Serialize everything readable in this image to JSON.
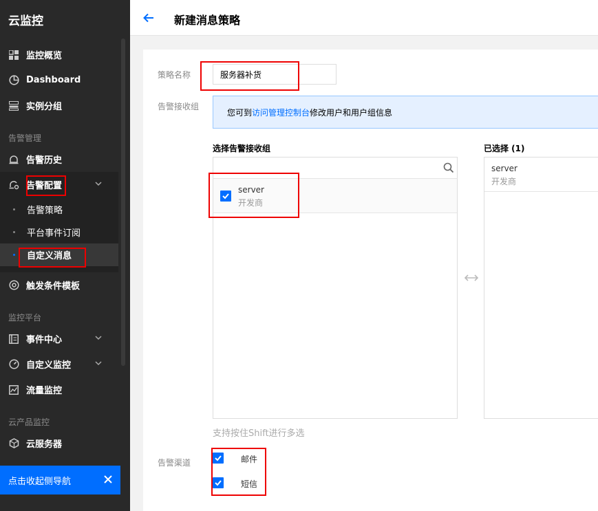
{
  "sidebar": {
    "app_title": "云监控",
    "items": [
      {
        "label": "监控概览",
        "icon": "grid-icon"
      },
      {
        "label": "Dashboard",
        "icon": "pie-chart-icon"
      },
      {
        "label": "实例分组",
        "icon": "list-group-icon"
      }
    ],
    "group_alarm": "告警管理",
    "alarm_history": "告警历史",
    "alarm_config": "告警配置",
    "sub_items": [
      "告警策略",
      "平台事件订阅",
      "自定义消息"
    ],
    "trigger_template": "触发条件模板",
    "group_platform": "监控平台",
    "event_center": "事件中心",
    "custom_monitor": "自定义监控",
    "traffic_monitor": "流量监控",
    "group_products": "云产品监控",
    "cvm": "云服务器",
    "toast": "点击收起侧导航"
  },
  "header": {
    "title": "新建消息策略"
  },
  "form": {
    "name_label": "策略名称",
    "name_value": "服务器补货",
    "receiver_label": "告警接收组",
    "info_prefix": "您可到",
    "info_link": "访问管理控制台",
    "info_suffix": "修改用户和用户组信息",
    "select_title": "选择告警接收组",
    "selected_title": "已选择 (1)",
    "search_placeholder": "",
    "available": [
      {
        "name": "server",
        "desc": "开发商",
        "checked": true
      }
    ],
    "selected": [
      {
        "name": "server",
        "desc": "开发商"
      }
    ],
    "hint": "支持按住Shift进行多选",
    "channel_label": "告警渠道",
    "channels": [
      {
        "label": "邮件",
        "checked": true
      },
      {
        "label": "短信",
        "checked": true
      }
    ]
  },
  "colors": {
    "accent": "#006eff",
    "sidebar_bg": "#292929",
    "highlight": "#e00000"
  }
}
